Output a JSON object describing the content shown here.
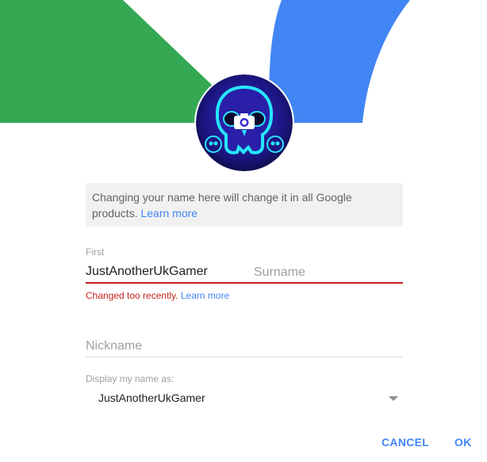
{
  "colors": {
    "banner_green": "#34a853",
    "banner_blue": "#4285f4",
    "error": "#c5221f",
    "link": "#4285f4"
  },
  "profile": {
    "avatar_icon": "skull-avatar-icon",
    "camera_icon": "camera-icon"
  },
  "notice": {
    "text": "Changing your name here will change it in all Google products.",
    "link": "Learn more"
  },
  "name": {
    "first_label": "First",
    "first_value": "JustAnotherUkGamer",
    "surname_placeholder": "Surname",
    "error_text": "Changed too recently.",
    "error_link": "Learn more"
  },
  "nickname": {
    "placeholder": "Nickname"
  },
  "display": {
    "label": "Display my name as:",
    "selected": "JustAnotherUkGamer"
  },
  "actions": {
    "cancel": "CANCEL",
    "ok": "OK"
  }
}
